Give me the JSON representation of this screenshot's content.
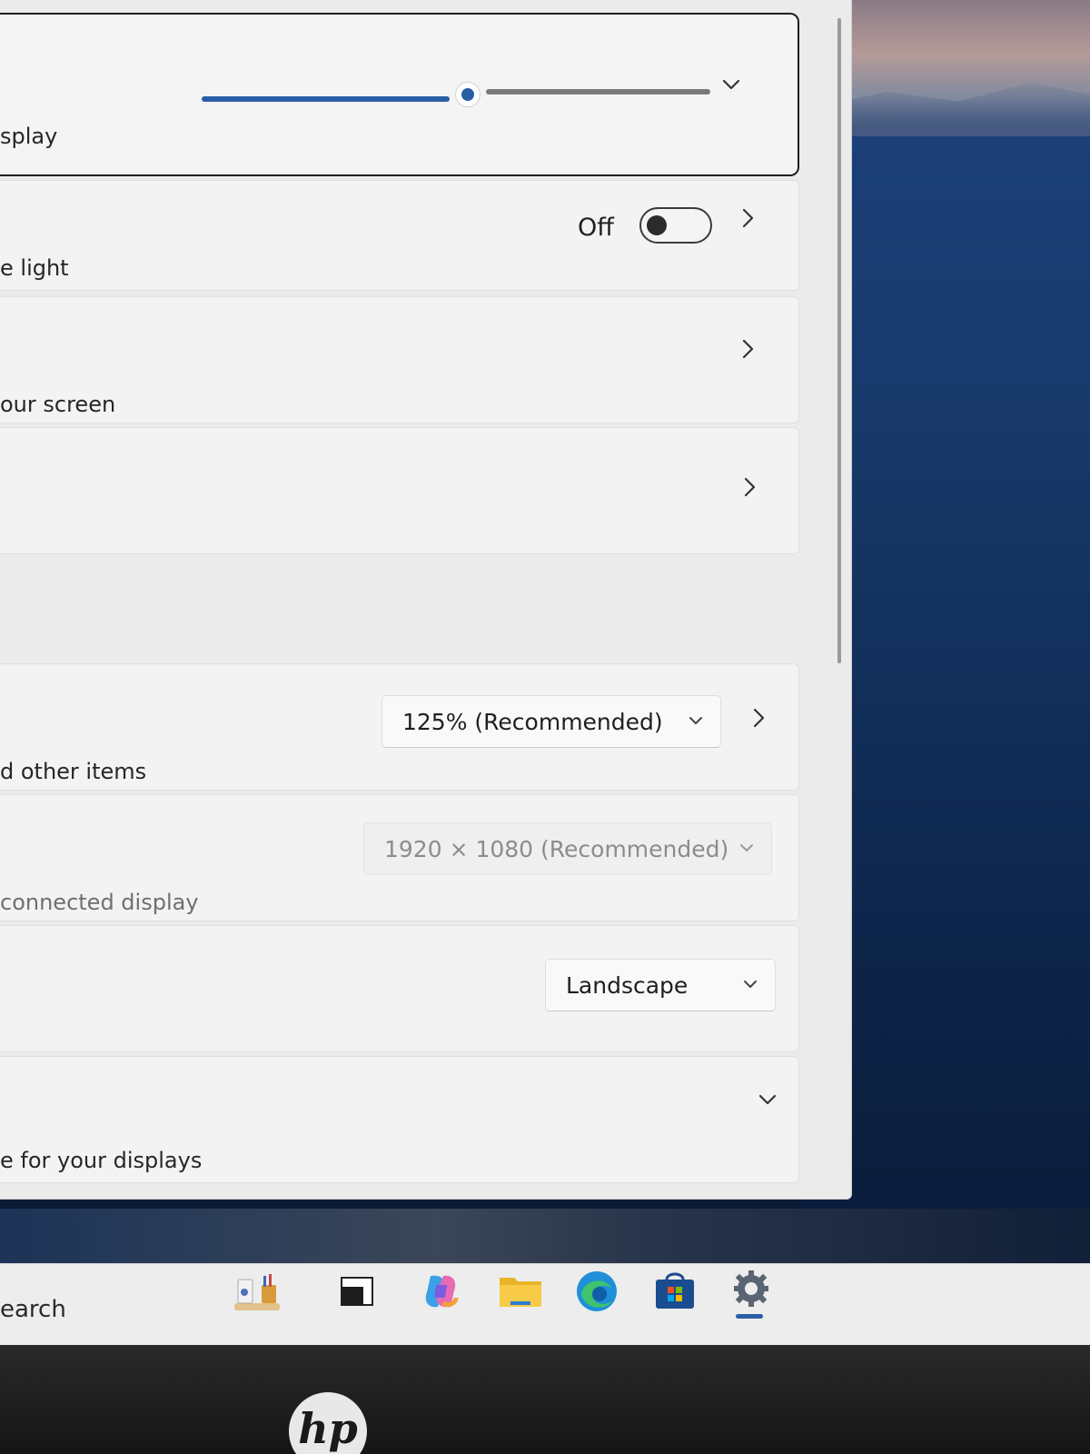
{
  "brightness_card": {
    "description": "splay",
    "brightness_level_fraction": 0.52
  },
  "night_light_card": {
    "description": "e light",
    "toggle_state_label": "Off"
  },
  "hdr_card": {
    "description": "our screen"
  },
  "scale_card": {
    "description": "d other items",
    "dropdown_value": "125% (Recommended)"
  },
  "resolution_card": {
    "description": "connected display",
    "dropdown_value": "1920 × 1080 (Recommended)"
  },
  "orientation_card": {
    "dropdown_value": "Landscape"
  },
  "multiple_displays_card": {
    "description": "e for your displays"
  },
  "taskbar": {
    "search_text": "earch"
  },
  "bezel": {
    "logo_text": "hp"
  },
  "colors": {
    "accent": "#2a5ea6",
    "window_bg": "#ebebeb",
    "card_bg": "#f3f3f3"
  }
}
